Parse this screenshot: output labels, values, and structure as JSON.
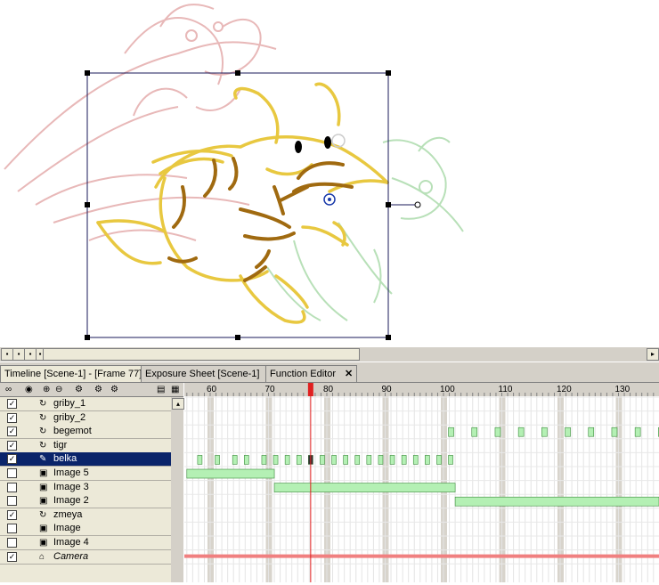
{
  "tabs": [
    {
      "label": "Timeline [Scene-1] - [Frame 77]",
      "active": true
    },
    {
      "label": "Exposure Sheet [Scene-1]",
      "active": false
    },
    {
      "label": "Function Editor",
      "active": false
    }
  ],
  "tab_close": "✕",
  "ruler_labels": [
    "60",
    "70",
    "80",
    "90",
    "100",
    "110",
    "120",
    "130"
  ],
  "current_frame": 77,
  "layers": [
    {
      "name": "griby_1",
      "checked": true,
      "icon": "linked-drawing-icon",
      "glyph": "↻",
      "italic": false,
      "selected": false
    },
    {
      "name": "griby_2",
      "checked": true,
      "icon": "linked-drawing-icon",
      "glyph": "↻",
      "italic": false,
      "selected": false
    },
    {
      "name": "begemot",
      "checked": true,
      "icon": "linked-drawing-icon",
      "glyph": "↻",
      "italic": false,
      "selected": false
    },
    {
      "name": "tigr",
      "checked": true,
      "icon": "linked-drawing-icon",
      "glyph": "↻",
      "italic": false,
      "selected": false
    },
    {
      "name": "belka",
      "checked": true,
      "icon": "pen-icon",
      "glyph": "✎",
      "italic": false,
      "selected": true
    },
    {
      "name": "Image 5",
      "checked": false,
      "icon": "image-icon",
      "glyph": "▣",
      "italic": false,
      "selected": false
    },
    {
      "name": "Image 3",
      "checked": false,
      "icon": "image-icon",
      "glyph": "▣",
      "italic": false,
      "selected": false
    },
    {
      "name": "Image 2",
      "checked": false,
      "icon": "image-icon",
      "glyph": "▣",
      "italic": false,
      "selected": false
    },
    {
      "name": "zmeya",
      "checked": true,
      "icon": "linked-drawing-icon",
      "glyph": "↻",
      "italic": false,
      "selected": false
    },
    {
      "name": "Image",
      "checked": false,
      "icon": "image-icon",
      "glyph": "▣",
      "italic": false,
      "selected": false
    },
    {
      "name": "Image 4",
      "checked": false,
      "icon": "image-icon",
      "glyph": "▣",
      "italic": false,
      "selected": false
    },
    {
      "name": "Camera",
      "checked": true,
      "icon": "camera-icon",
      "glyph": "⌂",
      "italic": true,
      "selected": false
    }
  ],
  "colors": {
    "keyframe": "#b4f0b4",
    "keyframe_border": "#3a8a3a",
    "playhead": "#e02020",
    "camera_bar": "#f08080",
    "stage_box": "#1a1a5a",
    "yellow": "#e8c840",
    "brown": "#a06a10",
    "pink": "#e8b8b8",
    "mint": "#b8e0b8"
  }
}
